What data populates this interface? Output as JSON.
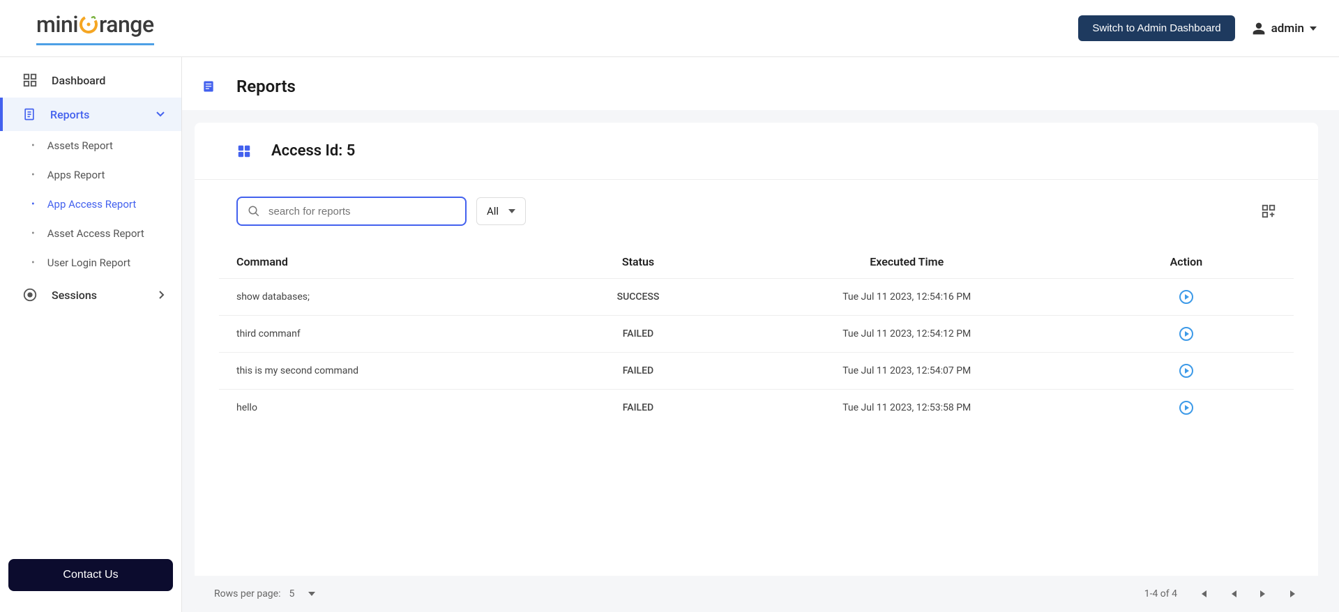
{
  "header": {
    "logo_mini": "mini",
    "logo_range": "range",
    "switch_label": "Switch to Admin Dashboard",
    "user_name": "admin"
  },
  "sidebar": {
    "dashboard": "Dashboard",
    "reports": "Reports",
    "sessions": "Sessions",
    "sub": {
      "assets_report": "Assets Report",
      "apps_report": "Apps Report",
      "app_access_report": "App Access Report",
      "asset_access_report": "Asset Access Report",
      "user_login_report": "User Login Report"
    },
    "contact": "Contact Us"
  },
  "page": {
    "title": "Reports",
    "card_title": "Access Id: 5",
    "search_placeholder": "search for reports",
    "filter_value": "All"
  },
  "table": {
    "headers": {
      "command": "Command",
      "status": "Status",
      "time": "Executed Time",
      "action": "Action"
    },
    "rows": [
      {
        "command": "show databases;",
        "status": "SUCCESS",
        "time": "Tue Jul 11 2023, 12:54:16 PM"
      },
      {
        "command": "third commanf",
        "status": "FAILED",
        "time": "Tue Jul 11 2023, 12:54:12 PM"
      },
      {
        "command": "this is my second command",
        "status": "FAILED",
        "time": "Tue Jul 11 2023, 12:54:07 PM"
      },
      {
        "command": "hello",
        "status": "FAILED",
        "time": "Tue Jul 11 2023, 12:53:58 PM"
      }
    ]
  },
  "footer": {
    "rows_per_page_label": "Rows per page:",
    "rows_per_page_value": "5",
    "page_info": "1-4 of 4"
  }
}
